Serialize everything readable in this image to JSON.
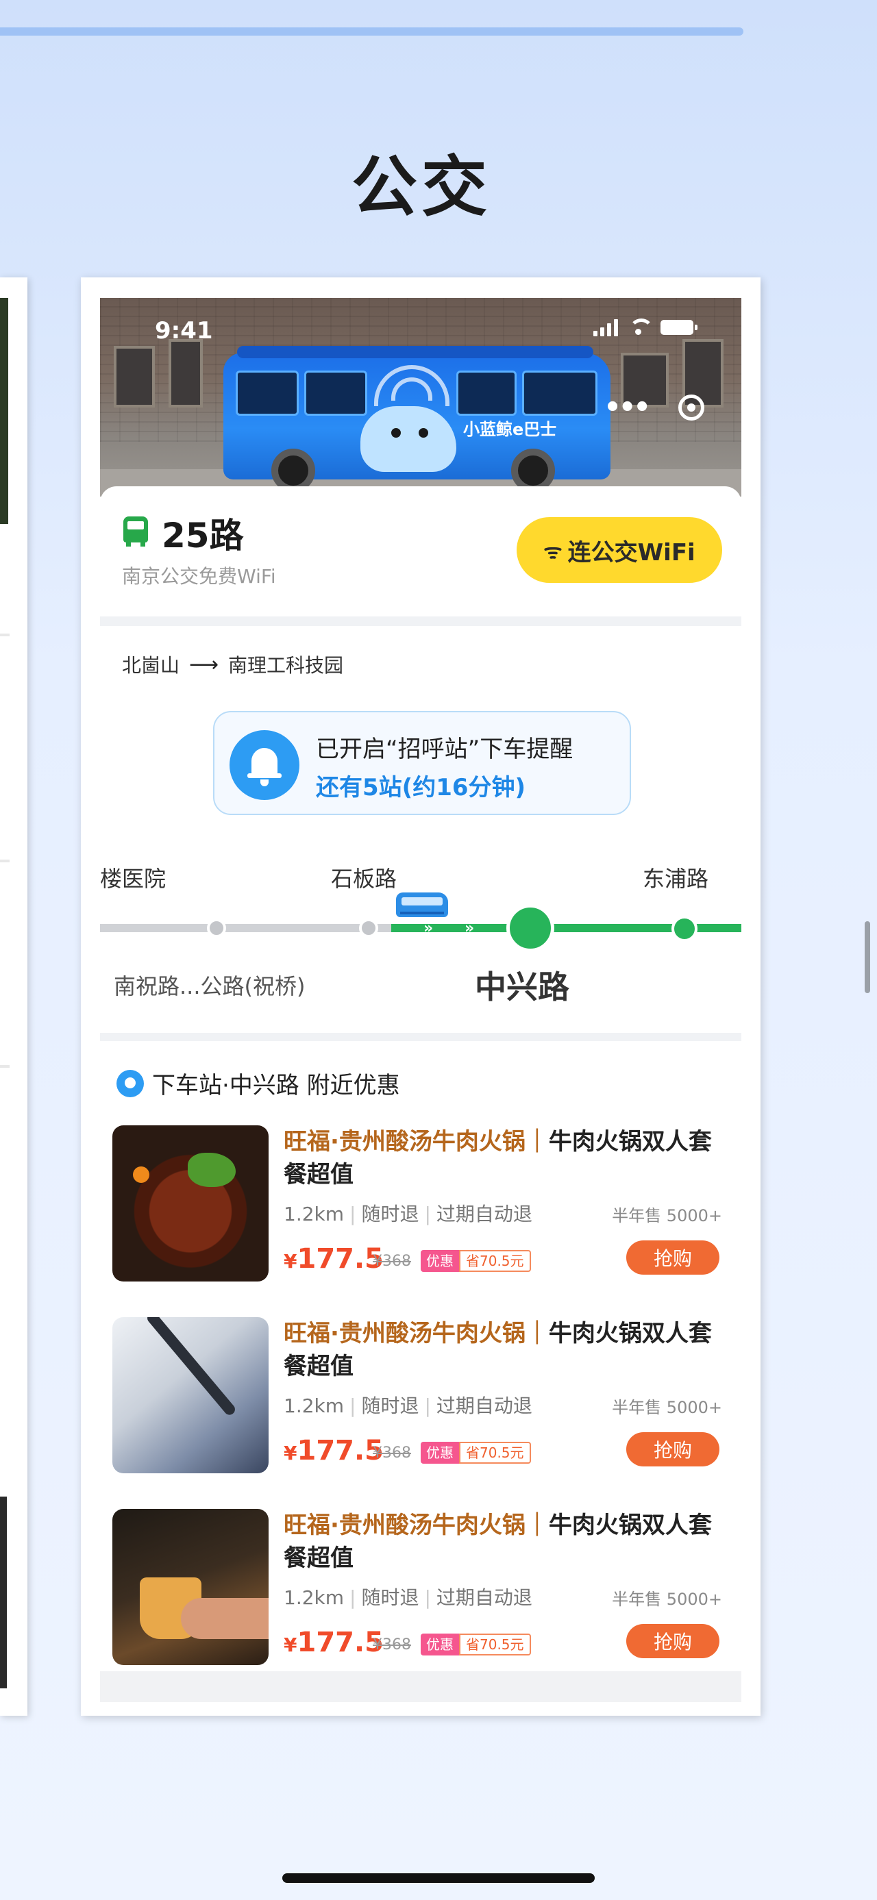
{
  "page": {
    "heading": "公交"
  },
  "status_bar": {
    "time": "9:41"
  },
  "hero": {
    "bus_brand": "小蓝鲸e巴士"
  },
  "route": {
    "name": "25路",
    "subtitle": "南京公交免费WiFi",
    "wifi_button": "连公交WiFi",
    "from": "北崮山",
    "to": "南理工科技园"
  },
  "reminder": {
    "line1": "已开启“招呼站”下车提醒",
    "line2": "还有5站(约16分钟)"
  },
  "stops": {
    "top": [
      "楼医院",
      "石板路",
      "东浦路"
    ],
    "bottom_prev": "南祝路...公路(祝桥)",
    "current": "中兴路"
  },
  "nearby": {
    "title": "下车站·中兴路 附近优惠",
    "deals": [
      {
        "title_highlight": "旺福·贵州酸汤牛肉火锅｜",
        "title_rest": "牛肉火锅双人套餐超值",
        "distance": "1.2km",
        "refund1": "随时退",
        "refund2": "过期自动退",
        "sold": "半年售 5000+",
        "currency": "¥",
        "price": "177.5",
        "original_price": "¥368",
        "tag": "优惠",
        "save": "省70.5元",
        "buy": "抢购",
        "thumb_icon": "hotpot-image"
      },
      {
        "title_highlight": "旺福·贵州酸汤牛肉火锅｜",
        "title_rest": "牛肉火锅双人套餐超值",
        "distance": "1.2km",
        "refund1": "随时退",
        "refund2": "过期自动退",
        "sold": "半年售 5000+",
        "currency": "¥",
        "price": "177.5",
        "original_price": "¥368",
        "tag": "优惠",
        "save": "省70.5元",
        "buy": "抢购",
        "thumb_icon": "skate-image"
      },
      {
        "title_highlight": "旺福·贵州酸汤牛肉火锅｜",
        "title_rest": "牛肉火锅双人套餐超值",
        "distance": "1.2km",
        "refund1": "随时退",
        "refund2": "过期自动退",
        "sold": "半年售 5000+",
        "currency": "¥",
        "price": "177.5",
        "original_price": "¥368",
        "tag": "优惠",
        "save": "省70.5元",
        "buy": "抢购",
        "thumb_icon": "beer-image"
      }
    ]
  },
  "colors": {
    "accent_green": "#27b45a",
    "accent_blue": "#1e87e6",
    "wifi_yellow": "#ffd92d",
    "price_red": "#f04b2a",
    "buy_orange": "#f06a33"
  }
}
